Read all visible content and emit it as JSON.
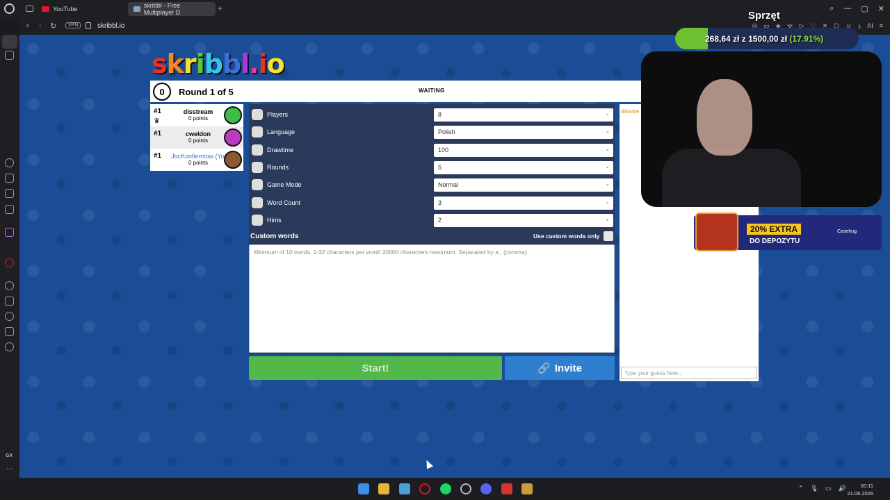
{
  "browser": {
    "tabs": [
      {
        "label": "YouTube"
      },
      {
        "label": "skribbl - Free Multiplayer D"
      }
    ],
    "vpn": "VPN",
    "url": "skribbl.io"
  },
  "game": {
    "logo": "skribbl.io",
    "round_number": "0",
    "round_text": "Round 1 of 5",
    "status": "WAITING",
    "players": [
      {
        "rank": "#1",
        "name": "disstream",
        "points": "0 points",
        "avatar_color": "#3bbd4a"
      },
      {
        "rank": "#1",
        "name": "cweldon",
        "points": "0 points",
        "avatar_color": "#b93bc0"
      },
      {
        "rank": "#1",
        "name": "JbcKonfiemtow (You)",
        "points": "0 points",
        "avatar_color": "#8a5a32"
      }
    ],
    "settings": [
      {
        "label": "Players",
        "value": "8"
      },
      {
        "label": "Language",
        "value": "Polish"
      },
      {
        "label": "Drawtime",
        "value": "100"
      },
      {
        "label": "Rounds",
        "value": "5"
      },
      {
        "label": "Game Mode",
        "value": "Normal"
      },
      {
        "label": "Word Count",
        "value": "3"
      },
      {
        "label": "Hints",
        "value": "2"
      }
    ],
    "custom_words_label": "Custom words",
    "custom_only_label": "Use custom words only",
    "custom_words_placeholder": "Minimum of 10 words. 1-32 characters per word! 20000 characters maximum. Separated by a , (comma)",
    "start_label": "Start!",
    "invite_label": "Invite",
    "chat_message": "disstre",
    "chat_placeholder": "Type your guess here..."
  },
  "overlay": {
    "goal_title": "Sprzęt",
    "goal_current": "268,64 zł",
    "goal_of": "z",
    "goal_target": "1500,00 zł",
    "goal_percent": "(17.91%)",
    "goal_fraction": 0.1791,
    "ad_extra": "20% EXTRA",
    "ad_deposit": "DO DEPOZYTU",
    "ad_brand": "Casehug"
  },
  "sidebar": {
    "gx_label": "GX"
  },
  "taskbar": {
    "time": "00:11",
    "date": "21.08.2026"
  },
  "colors": {
    "page_bg": "#1b4d96",
    "start_green": "#53b84a",
    "invite_blue": "#2f7fd1",
    "settings_bg": "#2b3a5a"
  }
}
